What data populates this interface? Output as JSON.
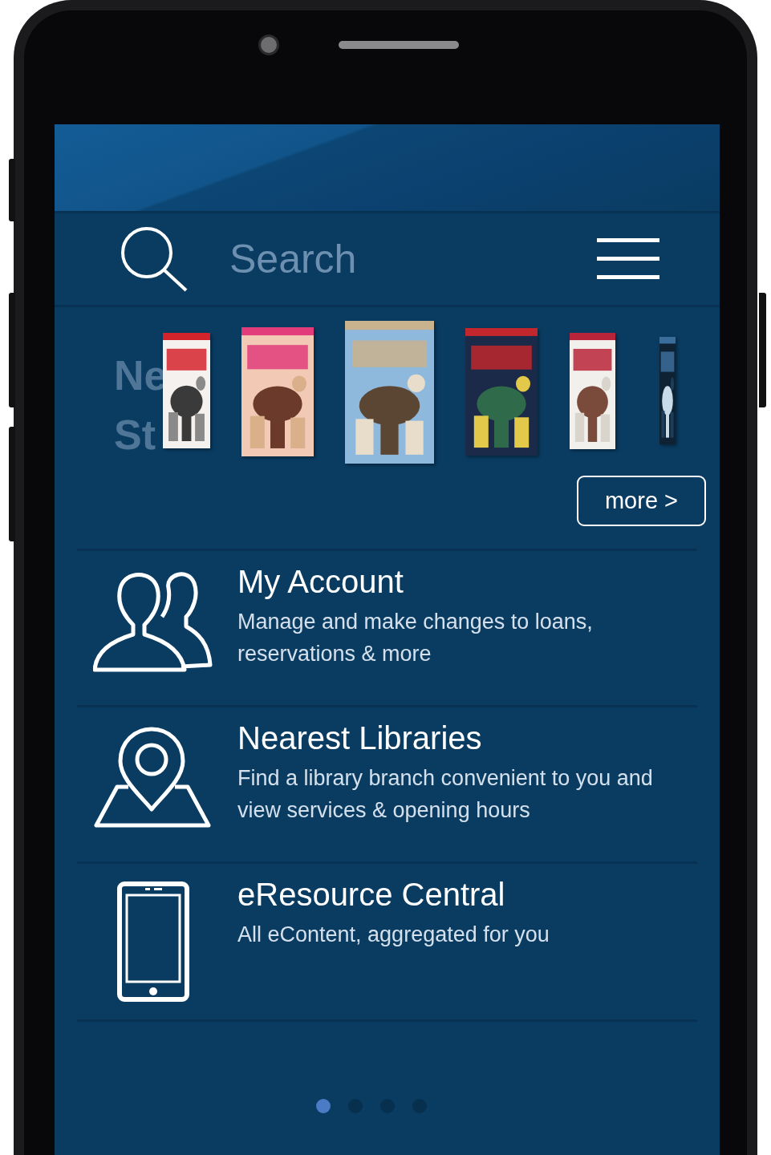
{
  "search": {
    "placeholder": "Search"
  },
  "new_stock": {
    "label_lines": [
      "Ne",
      "St"
    ],
    "covers": [
      {
        "kind": "picture"
      },
      {
        "kind": "picture"
      },
      {
        "kind": "picture"
      },
      {
        "kind": "picture"
      },
      {
        "kind": "picture"
      },
      {
        "kind": "picture"
      }
    ],
    "more_button": "more >"
  },
  "menu_items": [
    {
      "kind": "account",
      "title": "My Account",
      "description": "Manage and make changes to loans, reservations & more"
    },
    {
      "kind": "location",
      "title": "Nearest Libraries",
      "description": "Find a library branch convenient to you and view services & opening hours"
    },
    {
      "kind": "device",
      "title": "eResource Central",
      "description": "All eContent, aggregated for you"
    }
  ],
  "pager": [
    {
      "selected": true
    },
    {
      "selected": false
    },
    {
      "selected": false
    },
    {
      "selected": false
    }
  ]
}
